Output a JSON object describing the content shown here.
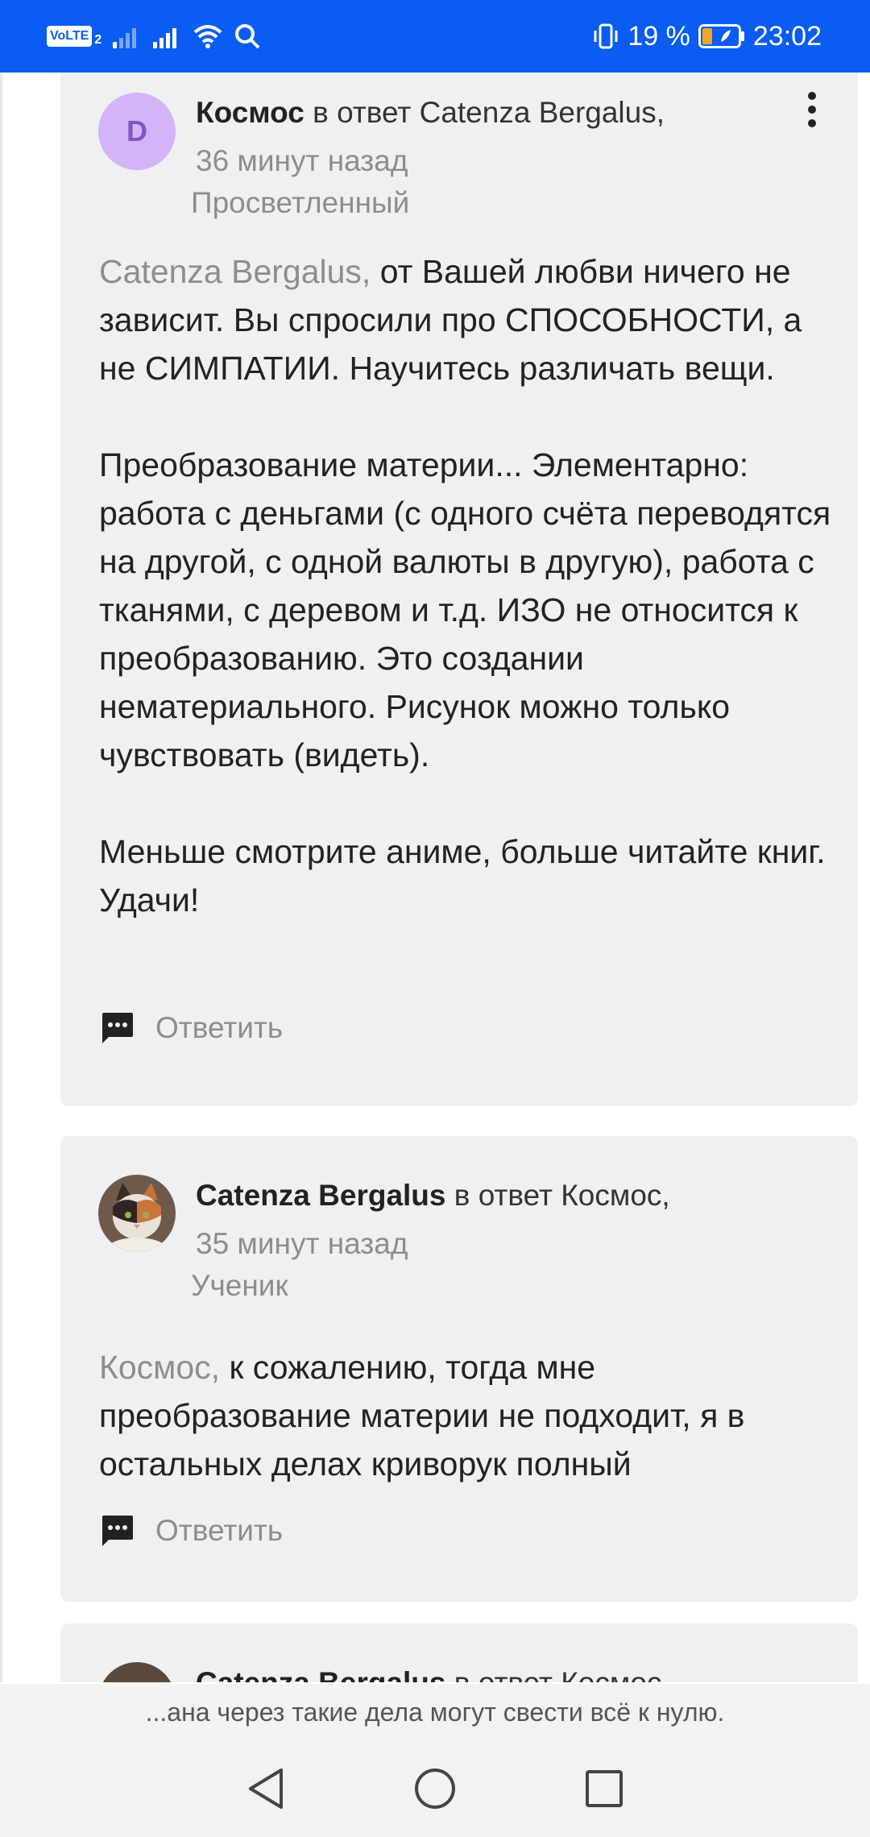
{
  "status_bar": {
    "volte_label": "VoLTE",
    "sim_number": "2",
    "battery_percent": "19 %",
    "time": "23:02",
    "icons": [
      "volte-icon",
      "signal-weak-icon",
      "signal-strong-icon",
      "wifi-icon",
      "search-icon",
      "vibrate-icon",
      "battery-icon"
    ]
  },
  "comments": [
    {
      "avatar_letter": "D",
      "author": "Космос",
      "reply_prefix": " в ответ ",
      "reply_to": "Catenza Bergalus",
      "separator": ",",
      "time": "36 минут назад",
      "rank": "Просветленный",
      "mention": "Catenza Bergalus,",
      "paragraphs": [
        " от Вашей любви ничего не зависит. Вы спросили про СПОСОБНОСТИ, а не СИМПАТИИ. Научитесь различать вещи.",
        "Преобразование материи... Элементарно: работа с деньгами (с одного счёта переводятся на другой, с одной валюты в другую), работа с тканями, с деревом и т.д. ИЗО не относится к преобразованию. Это создании нематериального. Рисунок можно только чувствовать (видеть).",
        "Меньше смотрите аниме, больше читайте книг. Удачи!"
      ],
      "reply_label": "Ответить"
    },
    {
      "author": "Catenza Bergalus",
      "reply_prefix": " в ответ ",
      "reply_to": "Космос",
      "separator": ",",
      "time": "35 минут назад",
      "rank": "Ученик",
      "mention": "Космос,",
      "paragraphs": [
        " к сожалению, тогда мне преобразование материи не подходит, я в остальных делах криворук полный"
      ],
      "reply_label": "Ответить"
    },
    {
      "author": "Catenza Bergalus",
      "reply_prefix": " в ответ ",
      "reply_to": "Космос"
    }
  ],
  "toast": "...ана через такие дела могут свести всё к нулю.",
  "nav": {
    "icons": [
      "back-icon",
      "home-icon",
      "recents-icon"
    ]
  },
  "colors": {
    "status_bar": "#0a5cf2",
    "card_bg": "#eff0f2",
    "muted_text": "#8d8d90",
    "avatar_purple": "#d3b4f8"
  }
}
